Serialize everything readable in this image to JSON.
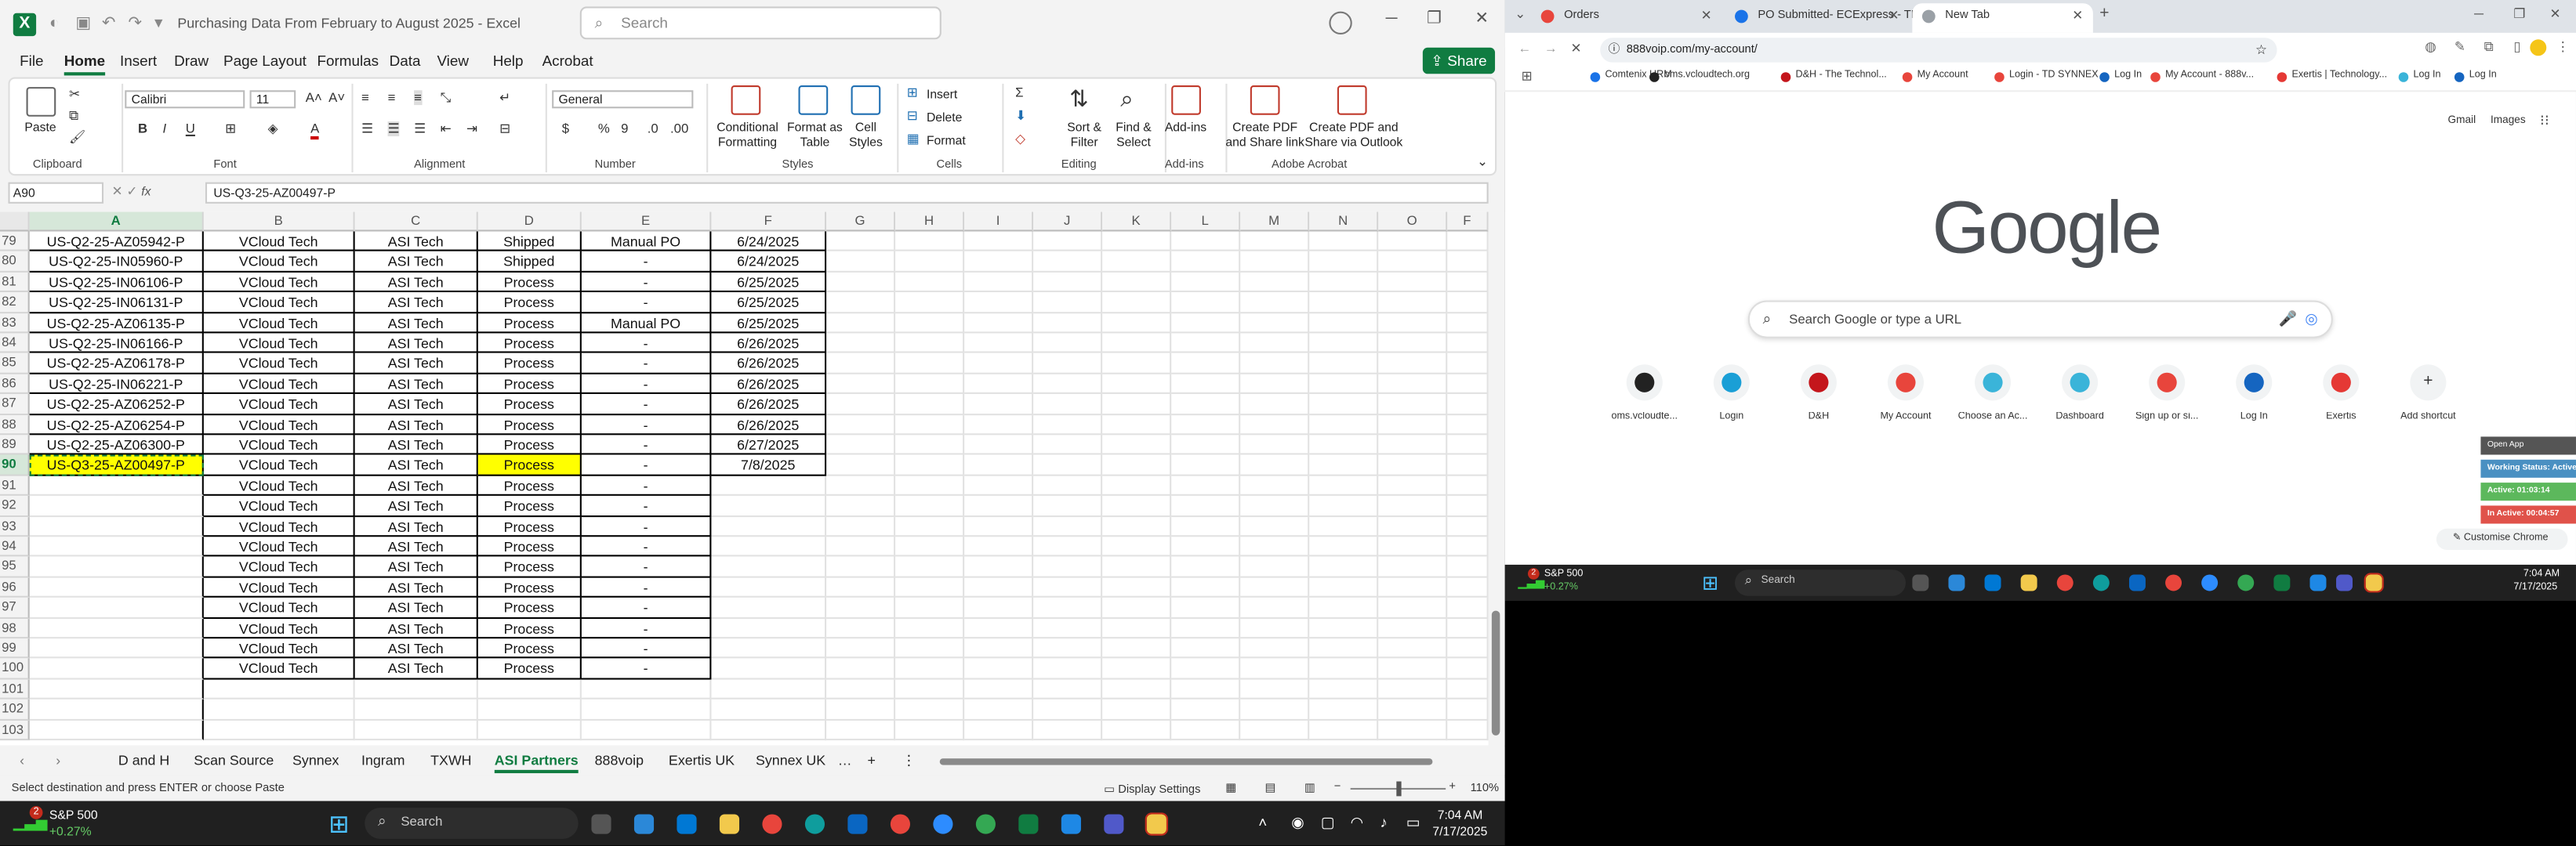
{
  "excel": {
    "doc_title": "Purchasing Data From February to August 2025",
    "app_name": "Excel",
    "search_placeholder": "Search",
    "ribbon_tabs": [
      "File",
      "Home",
      "Insert",
      "Draw",
      "Page Layout",
      "Formulas",
      "Data",
      "View",
      "Help",
      "Acrobat"
    ],
    "active_tab": "Home",
    "share_label": "Share",
    "ribbon": {
      "paste": "Paste",
      "clipboard": "Clipboard",
      "font_name": "Calibri",
      "font_size": "11",
      "font": "Font",
      "alignment": "Alignment",
      "number_format": "General",
      "number": "Number",
      "conditional_formatting": "Conditional Formatting",
      "format_as_table": "Format as Table",
      "cell_styles": "Cell Styles",
      "styles": "Styles",
      "insert": "Insert",
      "delete": "Delete",
      "format": "Format",
      "cells": "Cells",
      "sort_filter": "Sort & Filter",
      "find_select": "Find & Select",
      "editing": "Editing",
      "addins": "Add-ins",
      "addins_group": "Add-ins",
      "create_pdf_share": "Create PDF and Share link",
      "create_pdf_outlook": "Create PDF and Share via Outlook",
      "adobe_acrobat": "Adobe Acrobat"
    },
    "name_box": "A90",
    "formula": "US-Q3-25-AZ00497-P",
    "columns": [
      "A",
      "B",
      "C",
      "D",
      "E",
      "F",
      "G",
      "H",
      "I",
      "J",
      "K",
      "L",
      "M",
      "N",
      "O",
      "F"
    ],
    "rows": [
      {
        "n": "79",
        "a": "US-Q2-25-AZ05942-P",
        "b": "VCloud Tech",
        "c": "ASI Tech",
        "d": "Shipped",
        "e": "Manual PO",
        "f": "6/24/2025"
      },
      {
        "n": "80",
        "a": "US-Q2-25-IN05960-P",
        "b": "VCloud Tech",
        "c": "ASI Tech",
        "d": "Shipped",
        "e": "-",
        "f": "6/24/2025"
      },
      {
        "n": "81",
        "a": "US-Q2-25-IN06106-P",
        "b": "VCloud Tech",
        "c": "ASI Tech",
        "d": "Process",
        "e": "-",
        "f": "6/25/2025"
      },
      {
        "n": "82",
        "a": "US-Q2-25-IN06131-P",
        "b": "VCloud Tech",
        "c": "ASI Tech",
        "d": "Process",
        "e": "-",
        "f": "6/25/2025"
      },
      {
        "n": "83",
        "a": "US-Q2-25-AZ06135-P",
        "b": "VCloud Tech",
        "c": "ASI Tech",
        "d": "Process",
        "e": "Manual PO",
        "f": "6/25/2025"
      },
      {
        "n": "84",
        "a": "US-Q2-25-IN06166-P",
        "b": "VCloud Tech",
        "c": "ASI Tech",
        "d": "Process",
        "e": "-",
        "f": "6/26/2025"
      },
      {
        "n": "85",
        "a": "US-Q2-25-AZ06178-P",
        "b": "VCloud Tech",
        "c": "ASI Tech",
        "d": "Process",
        "e": "-",
        "f": "6/26/2025"
      },
      {
        "n": "86",
        "a": "US-Q2-25-IN06221-P",
        "b": "VCloud Tech",
        "c": "ASI Tech",
        "d": "Process",
        "e": "-",
        "f": "6/26/2025"
      },
      {
        "n": "87",
        "a": "US-Q2-25-AZ06252-P",
        "b": "VCloud Tech",
        "c": "ASI Tech",
        "d": "Process",
        "e": "-",
        "f": "6/26/2025"
      },
      {
        "n": "88",
        "a": "US-Q2-25-AZ06254-P",
        "b": "VCloud Tech",
        "c": "ASI Tech",
        "d": "Process",
        "e": "-",
        "f": "6/26/2025"
      },
      {
        "n": "89",
        "a": "US-Q2-25-AZ06300-P",
        "b": "VCloud Tech",
        "c": "ASI Tech",
        "d": "Process",
        "e": "-",
        "f": "6/27/2025"
      },
      {
        "n": "90",
        "a": "US-Q3-25-AZ00497-P",
        "b": "VCloud Tech",
        "c": "ASI Tech",
        "d": "Process",
        "e": "-",
        "f": "7/8/2025"
      },
      {
        "n": "91",
        "a": "",
        "b": "VCloud Tech",
        "c": "ASI Tech",
        "d": "Process",
        "e": "-",
        "f": ""
      },
      {
        "n": "92",
        "a": "",
        "b": "VCloud Tech",
        "c": "ASI Tech",
        "d": "Process",
        "e": "-",
        "f": ""
      },
      {
        "n": "93",
        "a": "",
        "b": "VCloud Tech",
        "c": "ASI Tech",
        "d": "Process",
        "e": "-",
        "f": ""
      },
      {
        "n": "94",
        "a": "",
        "b": "VCloud Tech",
        "c": "ASI Tech",
        "d": "Process",
        "e": "-",
        "f": ""
      },
      {
        "n": "95",
        "a": "",
        "b": "VCloud Tech",
        "c": "ASI Tech",
        "d": "Process",
        "e": "-",
        "f": ""
      },
      {
        "n": "96",
        "a": "",
        "b": "VCloud Tech",
        "c": "ASI Tech",
        "d": "Process",
        "e": "-",
        "f": ""
      },
      {
        "n": "97",
        "a": "",
        "b": "VCloud Tech",
        "c": "ASI Tech",
        "d": "Process",
        "e": "-",
        "f": ""
      },
      {
        "n": "98",
        "a": "",
        "b": "VCloud Tech",
        "c": "ASI Tech",
        "d": "Process",
        "e": "-",
        "f": ""
      },
      {
        "n": "99",
        "a": "",
        "b": "VCloud Tech",
        "c": "ASI Tech",
        "d": "Process",
        "e": "-",
        "f": ""
      },
      {
        "n": "100",
        "a": "",
        "b": "VCloud Tech",
        "c": "ASI Tech",
        "d": "Process",
        "e": "-",
        "f": ""
      },
      {
        "n": "101",
        "a": "",
        "b": "",
        "c": "",
        "d": "",
        "e": "",
        "f": ""
      },
      {
        "n": "102",
        "a": "",
        "b": "",
        "c": "",
        "d": "",
        "e": "",
        "f": ""
      },
      {
        "n": "103",
        "a": "",
        "b": "",
        "c": "",
        "d": "",
        "e": "",
        "f": ""
      }
    ],
    "sheet_tabs": [
      "D and H",
      "Scan Source",
      "Synnex",
      "Ingram",
      "TXWH",
      "ASI Partners",
      "888voip",
      "Exertis UK",
      "Synnex UK"
    ],
    "active_sheet": "ASI Partners",
    "status_text": "Select destination and press ENTER or choose Paste",
    "display_settings": "Display Settings",
    "zoom": "110%",
    "highlight_color": "#ffff00",
    "accent_color": "#107c41"
  },
  "chrome": {
    "tabs": [
      {
        "title": "Orders",
        "fav": "#e8453c"
      },
      {
        "title": "PO Submitted- ECExpress - TD",
        "fav": "#1a73e8"
      },
      {
        "title": "New Tab",
        "fav": "#9aa0a6"
      }
    ],
    "url": "888voip.com/my-account/",
    "bookmarks": [
      "Comtenix HRM",
      "oms.vcloudtech.org",
      "D&H - The Technol...",
      "My Account",
      "Login - TD SYNNEX",
      "Log In",
      "My Account - 888v...",
      "Exertis | Technology...",
      "Log In",
      "Log In"
    ],
    "top_links": [
      "Gmail",
      "Images"
    ],
    "logo": "Google",
    "search_placeholder": "Search Google or type a URL",
    "shortcuts": [
      {
        "label": "oms.vcloudte...",
        "color": "#222"
      },
      {
        "label": "Login",
        "color": "#1a9fd6"
      },
      {
        "label": "D&H",
        "color": "#c4161c"
      },
      {
        "label": "My Account",
        "color": "#e8453c"
      },
      {
        "label": "Choose an Ac...",
        "color": "#3ab4d9"
      },
      {
        "label": "Dashboard",
        "color": "#3ab4d9"
      },
      {
        "label": "Sign up or si...",
        "color": "#e8453c"
      },
      {
        "label": "Log In",
        "color": "#1565c0"
      },
      {
        "label": "Exertis",
        "color": "#e53935"
      },
      {
        "label": "Add shortcut",
        "color": "#f1f3f4"
      }
    ],
    "ext_panel": {
      "open": "Open App",
      "working": "Working Status: Active",
      "active": "Active: 01:03:14",
      "inactive": "In Active: 00:04:57"
    },
    "customise": "Customise Chrome"
  },
  "taskbar": {
    "stock_name": "S&P 500",
    "stock_change": "+0.27%",
    "notification_count": "2",
    "search_label": "Search",
    "time": "7:04 AM",
    "date": "7/17/2025"
  },
  "taskbar_small": {
    "stock_name": "S&P 500",
    "stock_change": "+0.27%",
    "notification_count": "2",
    "search_label": "Search",
    "time": "7:04 AM",
    "date": "7/17/2025"
  }
}
